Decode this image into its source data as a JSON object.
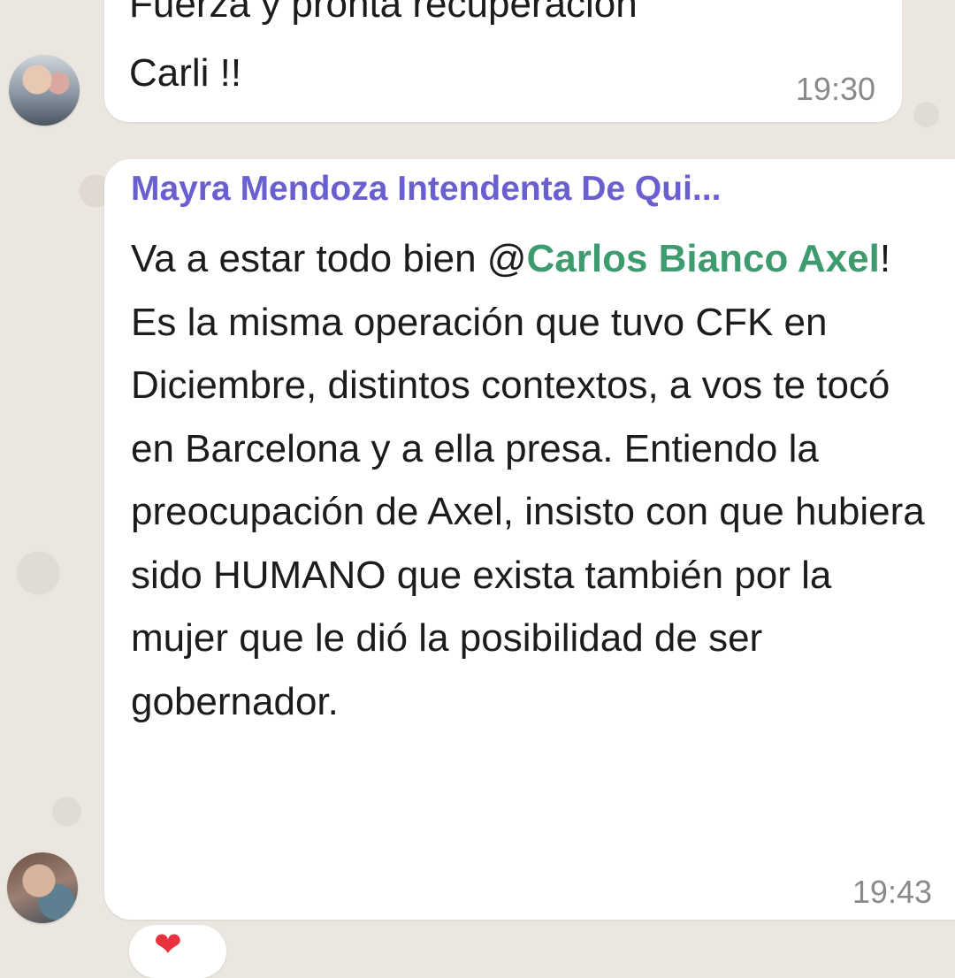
{
  "chat": {
    "messages": [
      {
        "text": "Fuerza y pronta recuperación\nCarli !!",
        "time": "19:30"
      },
      {
        "sender": "Mayra Mendoza Intendenta De Qui...",
        "text_before": "Va a estar todo bien @",
        "mention": "Carlos Bianco Axel",
        "text_after": "! Es la misma operación que tuvo CFK en Diciembre, distintos contextos, a vos te tocó en Barcelona y a ella presa. Entiendo la preocupación de Axel, insisto con que hubiera sido HUMANO que exista también por la mujer que le dió la posibilidad de ser gobernador.",
        "time": "19:43",
        "reaction_icon": "heart-icon",
        "reaction_emoji": "❤"
      }
    ]
  },
  "colors": {
    "sender_name": "#6a5fd0",
    "mention": "#3d9b6e",
    "wallpaper": "#ebe6df",
    "reaction_heart": "#e8333f"
  }
}
